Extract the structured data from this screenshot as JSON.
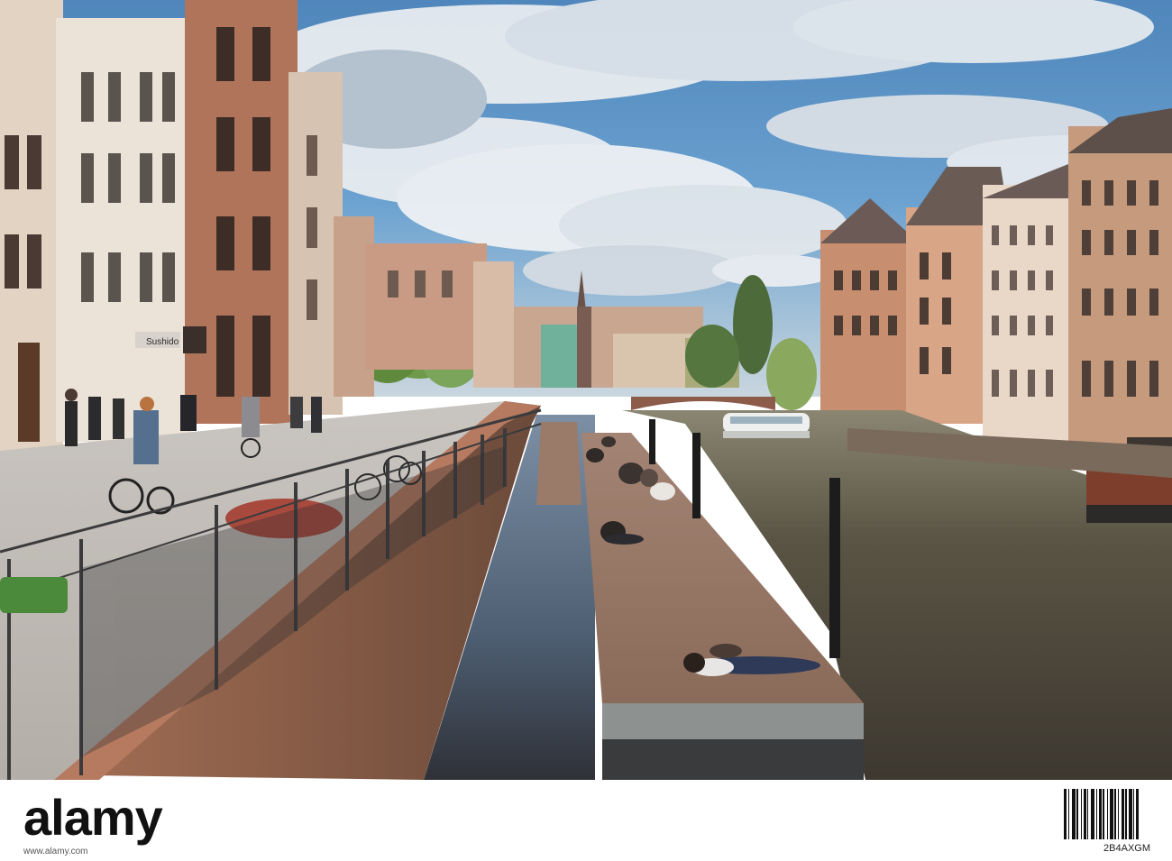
{
  "photo": {
    "description_visible_text": {
      "shop_sign": "Sushido"
    }
  },
  "stock_footer": {
    "logo_text": "alamy",
    "image_id": "www.alamy.com",
    "reference": "2B4AXGM"
  },
  "colors": {
    "sky_blue": "#5e97c9",
    "cloud": "#e9edf1",
    "water": "#4a4838",
    "pontoon_deck": "#8a6a58",
    "sandstone": "#b87d63",
    "footer_bg": "#ffffff"
  }
}
